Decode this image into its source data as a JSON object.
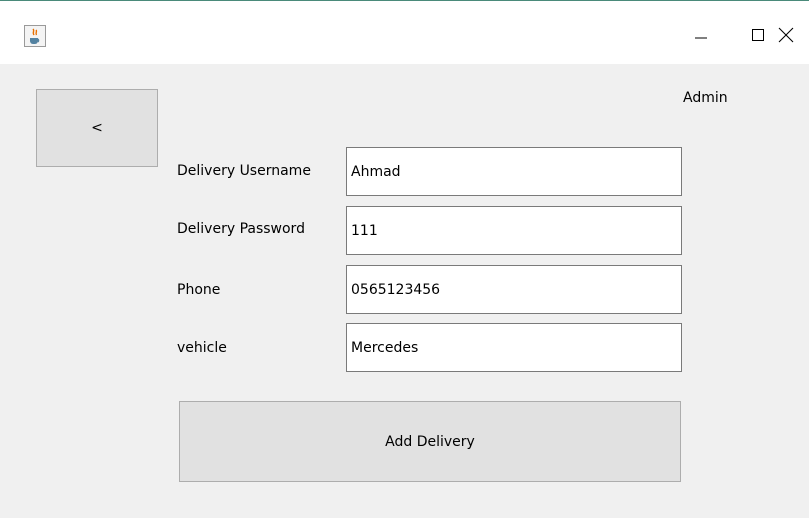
{
  "window": {
    "icon": "java-cup-icon",
    "controls": {
      "minimize": "—",
      "maximize": "☐",
      "close": "✕"
    }
  },
  "header": {
    "back_label": "<",
    "user_label": "Admin"
  },
  "form": {
    "fields": [
      {
        "label": "Delivery Username",
        "value": "Ahmad"
      },
      {
        "label": "Delivery Password",
        "value": "111"
      },
      {
        "label": "Phone",
        "value": "0565123456"
      },
      {
        "label": "vehicle",
        "value": "Mercedes"
      }
    ],
    "submit_label": "Add Delivery"
  },
  "colors": {
    "panel_bg": "#f0f0f0",
    "button_bg": "#e1e1e1",
    "input_border": "#7a7a7a"
  }
}
